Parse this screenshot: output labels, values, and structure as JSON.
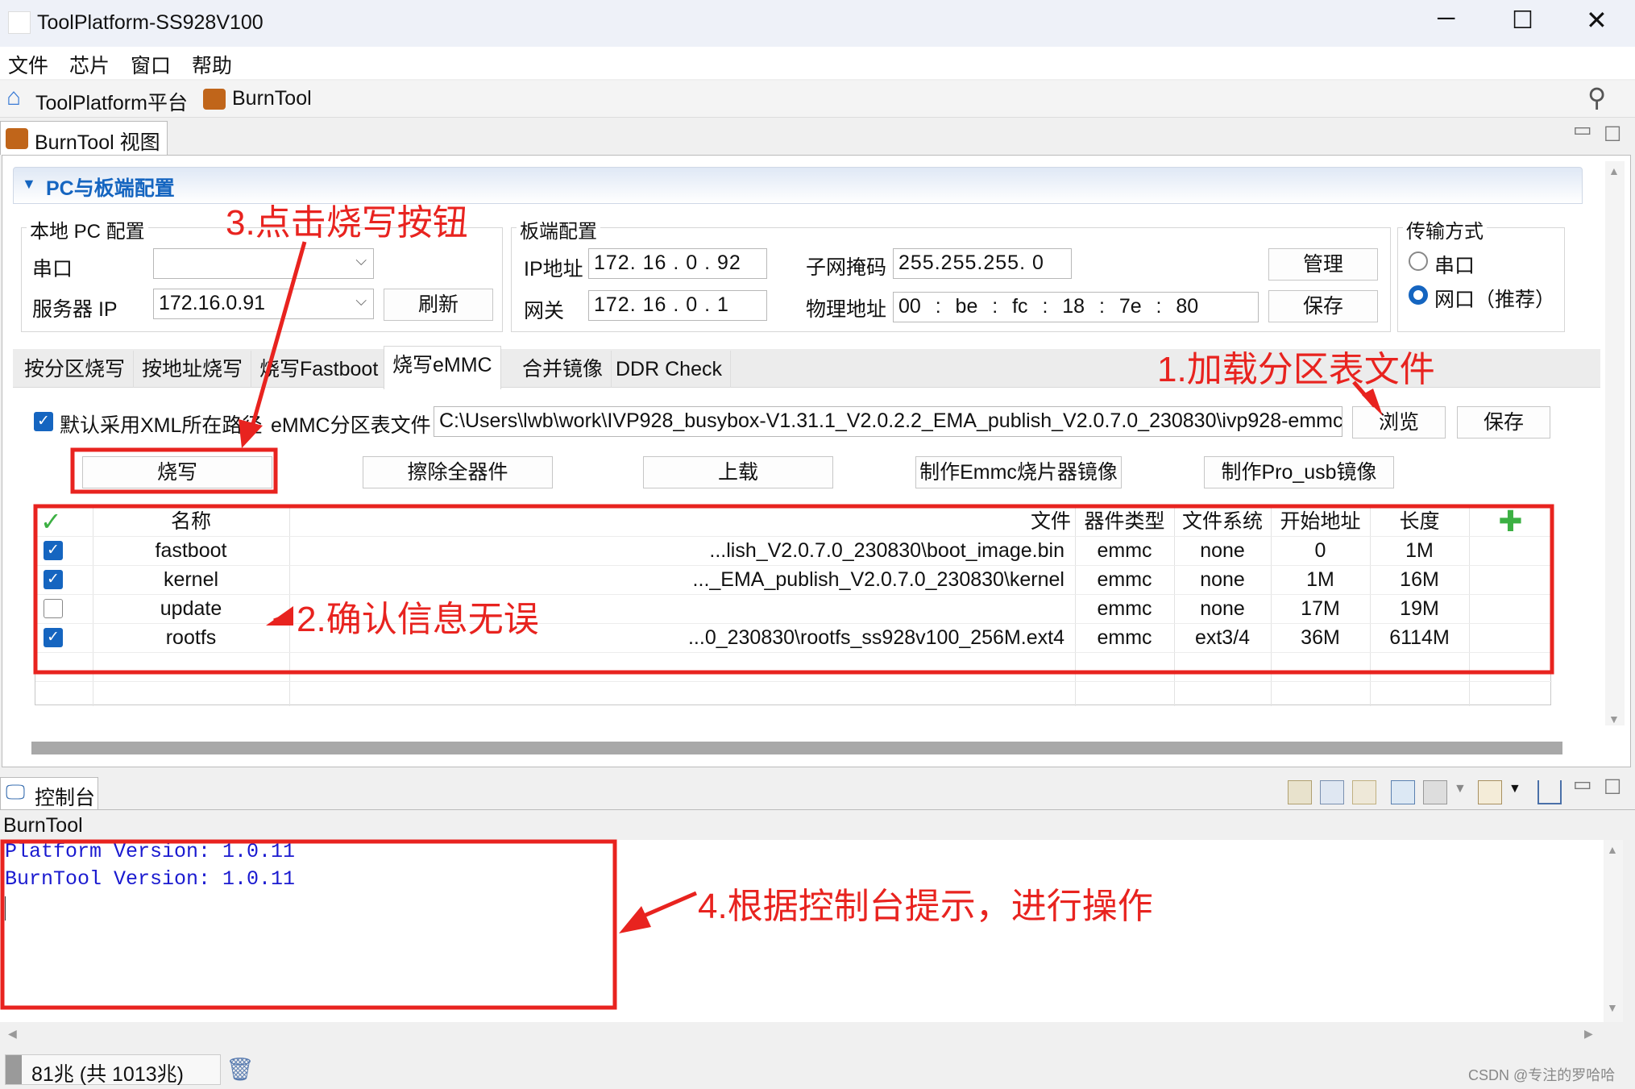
{
  "window": {
    "title": "ToolPlatform-SS928V100"
  },
  "menu": [
    "文件",
    "芯片",
    "窗口",
    "帮助"
  ],
  "toolbar": {
    "platform": "ToolPlatform平台",
    "burntool": "BurnTool"
  },
  "view_tab": "BurnTool 视图",
  "section": {
    "title": "PC与板端配置"
  },
  "local_pc": {
    "title": "本地 PC 配置",
    "serial_label": "串口",
    "serial_value": "",
    "server_ip_label": "服务器 IP",
    "server_ip_value": "172.16.0.91",
    "refresh": "刷新"
  },
  "board": {
    "title": "板端配置",
    "ip_label": "IP地址",
    "ip": [
      "172",
      "16",
      "0",
      "92"
    ],
    "gateway_label": "网关",
    "gateway": [
      "172",
      "16",
      "0",
      "1"
    ],
    "mask_label": "子网掩码",
    "mask": [
      "255",
      "255",
      "255",
      "0"
    ],
    "mac_label": "物理地址",
    "mac": [
      "00",
      "be",
      "fc",
      "18",
      "7e",
      "80"
    ],
    "manage": "管理",
    "save": "保存"
  },
  "transfer": {
    "title": "传输方式",
    "options": [
      "串口",
      "网口（推荐）"
    ],
    "selected": 1
  },
  "tabs": [
    "按分区烧写",
    "按地址烧写",
    "烧写Fastboot",
    "烧写eMMC",
    "合并镜像",
    "DDR Check"
  ],
  "active_tab": 3,
  "emmc": {
    "default_xml_label": "默认采用XML所在路径",
    "default_xml_checked": true,
    "file_label": "eMMC分区表文件",
    "file_path": "C:\\Users\\lwb\\work\\IVP928_busybox-V1.31.1_V2.0.2.2_EMA_publish_V2.0.7.0_230830\\ivp928-emmc",
    "browse": "浏览",
    "save": "保存"
  },
  "actions": [
    "烧写",
    "擦除全器件",
    "上载",
    "制作Emmc烧片器镜像",
    "制作Pro_usb镜像"
  ],
  "table": {
    "headers": [
      "名称",
      "文件",
      "器件类型",
      "文件系统",
      "开始地址",
      "长度"
    ],
    "rows": [
      {
        "checked": true,
        "name": "fastboot",
        "file": "...lish_V2.0.7.0_230830\\boot_image.bin",
        "type": "emmc",
        "fs": "none",
        "start": "0",
        "length": "1M"
      },
      {
        "checked": true,
        "name": "kernel",
        "file": "..._EMA_publish_V2.0.7.0_230830\\kernel",
        "type": "emmc",
        "fs": "none",
        "start": "1M",
        "length": "16M"
      },
      {
        "checked": false,
        "name": "update",
        "file": "",
        "type": "emmc",
        "fs": "none",
        "start": "17M",
        "length": "19M"
      },
      {
        "checked": true,
        "name": "rootfs",
        "file": "...0_230830\\rootfs_ss928v100_256M.ext4",
        "type": "emmc",
        "fs": "ext3/4",
        "start": "36M",
        "length": "6114M"
      }
    ]
  },
  "console": {
    "tab": "控制台",
    "name": "BurnTool",
    "lines": [
      "Platform Version: 1.0.11",
      "BurnTool Version: 1.0.11"
    ]
  },
  "status": {
    "memory": "81兆 (共 1013兆)"
  },
  "annotations": [
    "1.加载分区表文件",
    "2.确认信息无误",
    "3.点击烧写按钮",
    "4.根据控制台提示，进行操作"
  ],
  "watermark": "CSDN @专注的罗哈哈",
  "colors": {
    "annotation": "#e8231f",
    "link_blue": "#1565c0"
  }
}
